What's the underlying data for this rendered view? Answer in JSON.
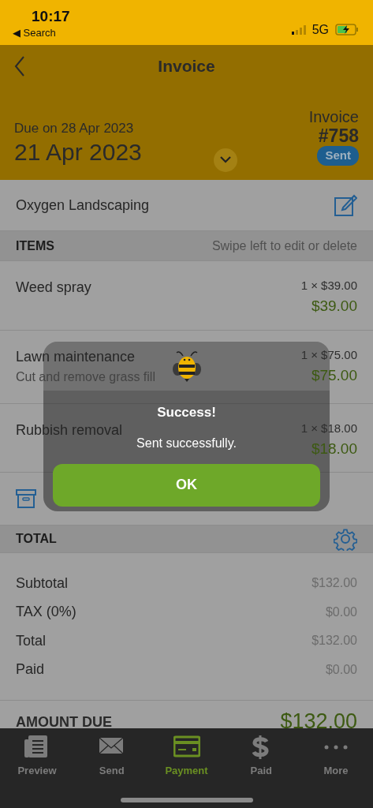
{
  "status_bar": {
    "time": "10:17",
    "back_label": "◀ Search",
    "network": "5G"
  },
  "nav": {
    "title": "Invoice"
  },
  "header": {
    "due": "Due on 28 Apr 2023",
    "date": "21 Apr 2023",
    "doc_label": "Invoice",
    "number": "#758",
    "status": "Sent"
  },
  "client": {
    "name": "Oxygen Landscaping"
  },
  "items_section": {
    "title": "ITEMS",
    "hint": "Swipe left to edit or delete"
  },
  "items": [
    {
      "name": "Weed spray",
      "qty_price": "1 × $39.00",
      "amount": "$39.00"
    },
    {
      "name": "Lawn maintenance",
      "description": "Cut and remove grass fill",
      "qty_price": "1 × $75.00",
      "amount": "$75.00"
    },
    {
      "name": "Rubbish removal",
      "qty_price": "1 × $18.00",
      "amount": "$18.00"
    }
  ],
  "total_section": {
    "title": "TOTAL"
  },
  "totals": [
    {
      "label": "Subtotal",
      "value": "$132.00"
    },
    {
      "label": "TAX (0%)",
      "value": "$0.00"
    },
    {
      "label": "Total",
      "value": "$132.00"
    },
    {
      "label": "Paid",
      "value": "$0.00"
    }
  ],
  "amount_due": {
    "label": "AMOUNT DUE",
    "value": "$132.00"
  },
  "dialog": {
    "title": "Success!",
    "message": "Sent successfully.",
    "button": "OK"
  },
  "tabs": [
    {
      "kind": "preview",
      "label": "Preview",
      "selected": false
    },
    {
      "kind": "send",
      "label": "Send",
      "selected": false
    },
    {
      "kind": "payment",
      "label": "Payment",
      "selected": true
    },
    {
      "kind": "paid",
      "label": "Paid",
      "selected": false
    },
    {
      "kind": "more",
      "label": "More",
      "selected": false
    }
  ]
}
